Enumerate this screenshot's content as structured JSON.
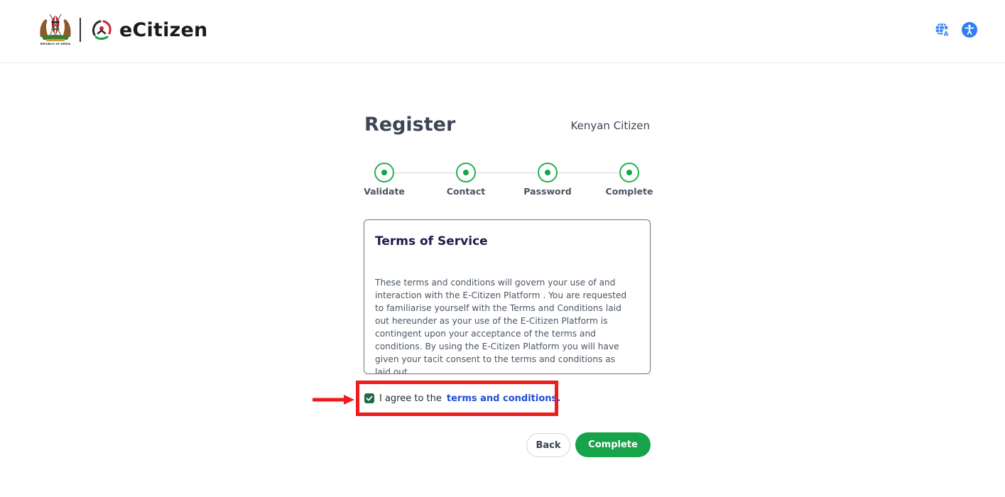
{
  "header": {
    "coat_of_arms_text": "REPUBLIC OF KENYA",
    "brand_name": "eCitizen",
    "language_icon": "globe-language-icon",
    "accessibility_icon": "accessibility-icon"
  },
  "register": {
    "title": "Register",
    "subtitle": "Kenyan Citizen",
    "steps": [
      {
        "label": "Validate"
      },
      {
        "label": "Contact"
      },
      {
        "label": "Password"
      },
      {
        "label": "Complete"
      }
    ]
  },
  "terms": {
    "title": "Terms of Service",
    "body": "These terms and conditions will govern your use of and interaction with the E-Citizen Platform . You are requested to familiarise yourself with the Terms and Conditions  laid out hereunder as your use of the E-Citizen Platform is contingent upon your acceptance of the terms and conditions. By using the E-Citizen Platform you will have given your tacit consent to the terms and conditions as laid out."
  },
  "agreement": {
    "checked": true,
    "text": "I agree to the",
    "link": "terms and conditions."
  },
  "actions": {
    "back_label": "Back",
    "complete_label": "Complete"
  },
  "colors": {
    "primary_green": "#16a34a",
    "checkbox_green": "#1f6b48",
    "link_blue": "#1d4ed8",
    "annotation_red": "#ee1c1c",
    "accessibility_blue": "#2f7ef5"
  }
}
